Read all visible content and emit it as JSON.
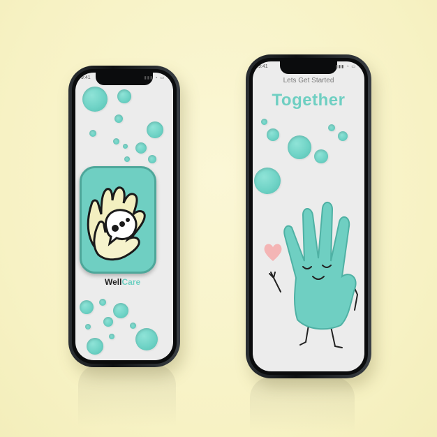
{
  "phones": [
    {
      "status_time": "9:41",
      "app_name": {
        "part1": "Well",
        "part2": "Care"
      },
      "colors": {
        "part1": "#222222",
        "part2": "#6fcfc2"
      }
    },
    {
      "status_time": "9:41",
      "intro_text": "Lets Get Started",
      "headline": "Together"
    }
  ],
  "colors": {
    "accent": "#6fcfc2",
    "heart": "#f4b5b5",
    "background": "#f7f2c4"
  },
  "icons": [
    "app-logo-hands-icon",
    "chat-bubble-icon",
    "hand-character-icon",
    "heart-icon"
  ]
}
